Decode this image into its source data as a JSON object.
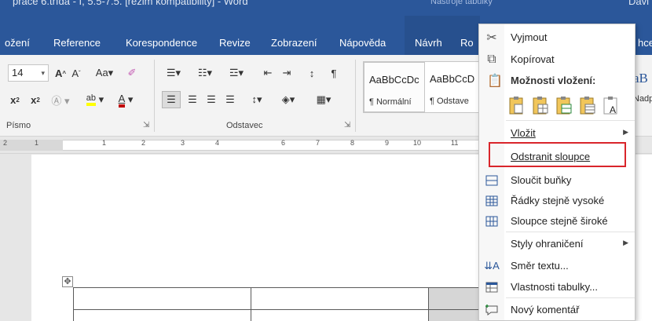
{
  "titlebar": {
    "title": "práce 6.třída - I, 5.5-7.5. [režim kompatibility] - Word",
    "context_tools": "Nástroje tabulky",
    "user": "Davi"
  },
  "tabs": [
    {
      "label": "ožení"
    },
    {
      "label": "Reference"
    },
    {
      "label": "Korespondence"
    },
    {
      "label": "Revize"
    },
    {
      "label": "Zobrazení"
    },
    {
      "label": "Nápověda"
    },
    {
      "label": "Návrh"
    },
    {
      "label": "Ro"
    },
    {
      "label": "hce"
    }
  ],
  "ribbon": {
    "font_size": "14",
    "group_font": "Písmo",
    "group_paragraph": "Odstavec",
    "styles": [
      {
        "sample": "AaBbCcDc",
        "name": "¶ Normální"
      },
      {
        "sample": "AaBbCcD",
        "name": "¶ Odstave"
      }
    ],
    "style_right_sample": "aB",
    "style_right_name": "Nadp"
  },
  "ruler": {
    "marks": [
      "2",
      "1",
      "1",
      "2",
      "3",
      "4",
      "6",
      "7",
      "8",
      "9",
      "10",
      "11"
    ]
  },
  "menu": {
    "items": [
      {
        "label": "Vyjmout",
        "icon": "scissors-icon"
      },
      {
        "label": "Kopírovat",
        "icon": "copy-icon"
      },
      {
        "label": "Vložit",
        "icon": "",
        "submenu": true
      },
      {
        "label": "Odstranit sloupce",
        "icon": ""
      },
      {
        "label": "Sloučit buňky",
        "icon": "merge-cells-icon"
      },
      {
        "label": "Řádky stejně vysoké",
        "icon": "distribute-rows-icon"
      },
      {
        "label": "Sloupce stejně široké",
        "icon": "distribute-columns-icon"
      },
      {
        "label": "Styly ohraničení",
        "icon": "",
        "submenu": true
      },
      {
        "label": "Směr textu...",
        "icon": "text-direction-icon"
      },
      {
        "label": "Vlastnosti tabulky...",
        "icon": "table-properties-icon"
      },
      {
        "label": "Nový komentář",
        "icon": "new-comment-icon"
      }
    ],
    "paste_header": "Možnosti vložení:"
  },
  "colors": {
    "word_blue": "#2b579a",
    "highlight_red": "#d9252b",
    "font_red": "#c00000",
    "highlight_yellow": "#ffff00"
  }
}
